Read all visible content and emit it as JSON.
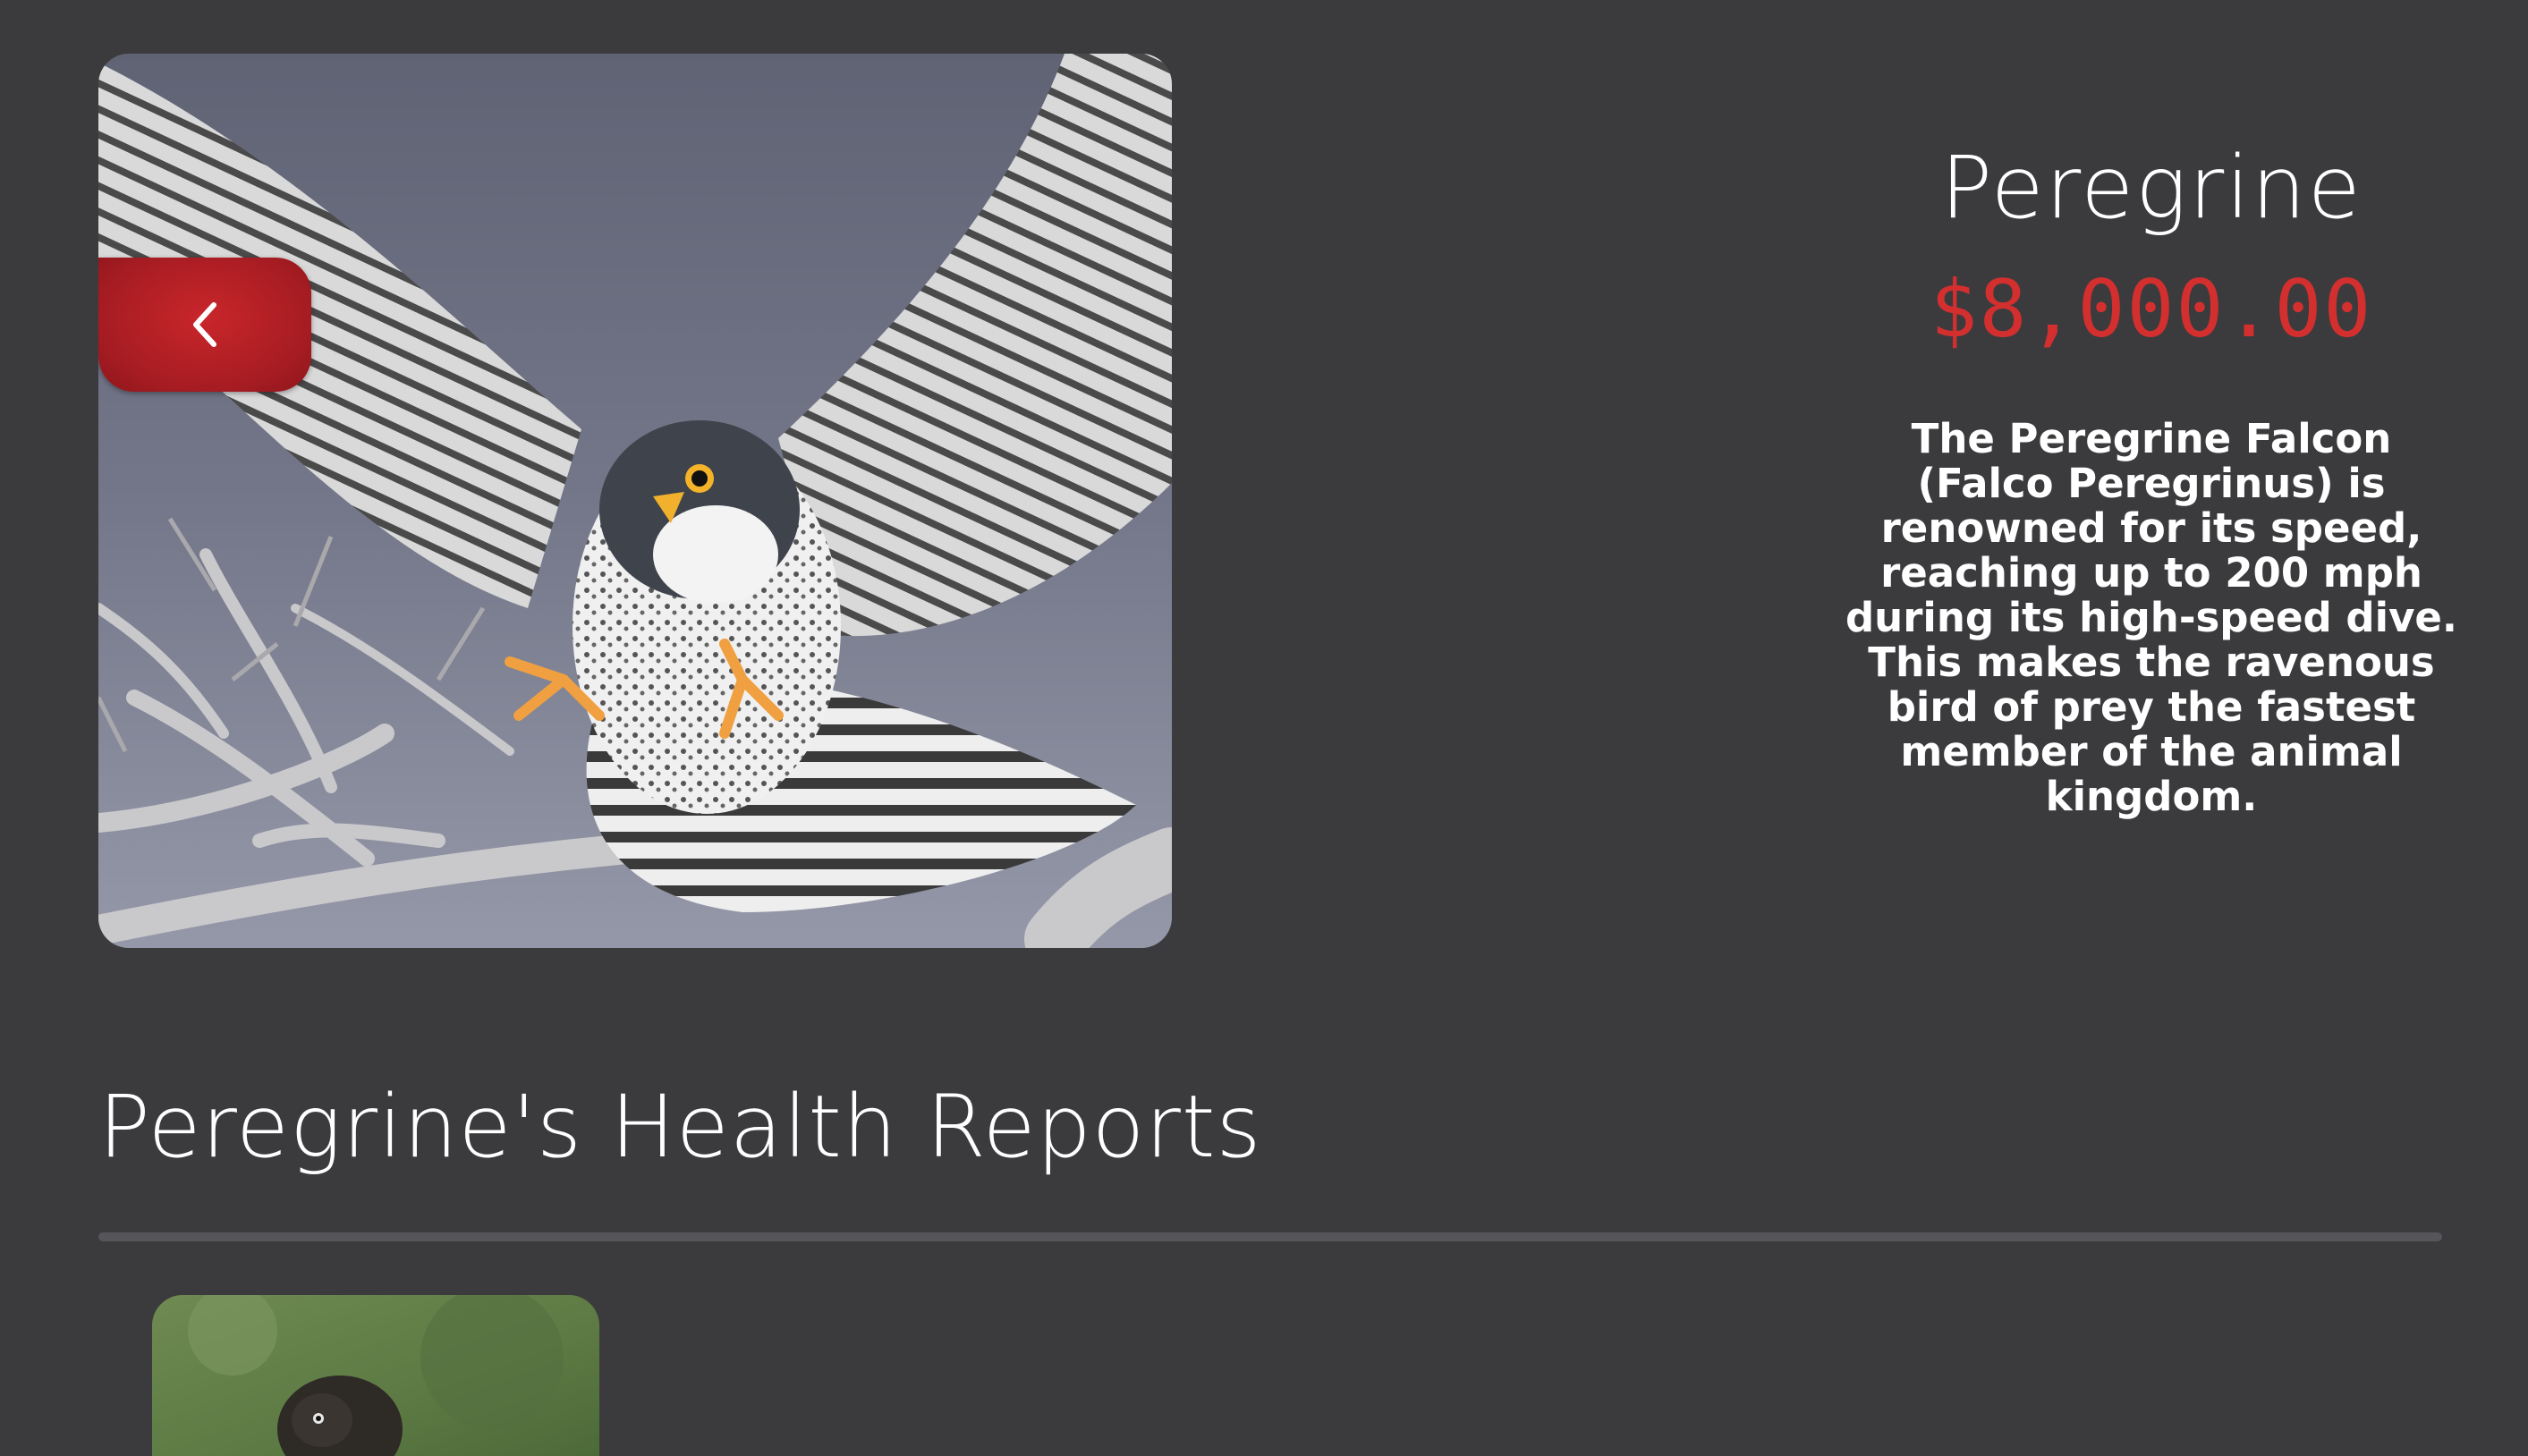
{
  "product": {
    "name": "Peregrine",
    "price": "$8,000.00",
    "description": "The Peregrine Falcon (Falco Peregrinus) is renowned for its speed, reaching up to 200 mph during its high-speed dive. This makes the ravenous bird of prey the fastest member of the animal kingdom."
  },
  "back_button": {
    "icon": "chevron-left-icon",
    "glyph": "‹"
  },
  "health_reports": {
    "title": "Peregrine's Health Reports",
    "items": [
      {
        "image": "falcon-thumbnail"
      }
    ]
  },
  "colors": {
    "background": "#3b3b3e",
    "accent": "#d32f2f",
    "button": "#b01f25",
    "divider": "#56565a"
  }
}
